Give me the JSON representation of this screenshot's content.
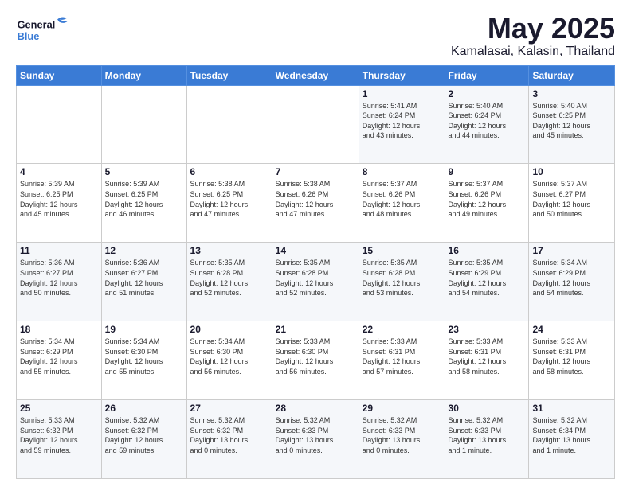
{
  "header": {
    "logo_general": "General",
    "logo_blue": "Blue",
    "title": "May 2025",
    "subtitle": "Kamalasai, Kalasin, Thailand"
  },
  "days_of_week": [
    "Sunday",
    "Monday",
    "Tuesday",
    "Wednesday",
    "Thursday",
    "Friday",
    "Saturday"
  ],
  "weeks": [
    [
      {
        "day": "",
        "info": ""
      },
      {
        "day": "",
        "info": ""
      },
      {
        "day": "",
        "info": ""
      },
      {
        "day": "",
        "info": ""
      },
      {
        "day": "1",
        "info": "Sunrise: 5:41 AM\nSunset: 6:24 PM\nDaylight: 12 hours\nand 43 minutes."
      },
      {
        "day": "2",
        "info": "Sunrise: 5:40 AM\nSunset: 6:24 PM\nDaylight: 12 hours\nand 44 minutes."
      },
      {
        "day": "3",
        "info": "Sunrise: 5:40 AM\nSunset: 6:25 PM\nDaylight: 12 hours\nand 45 minutes."
      }
    ],
    [
      {
        "day": "4",
        "info": "Sunrise: 5:39 AM\nSunset: 6:25 PM\nDaylight: 12 hours\nand 45 minutes."
      },
      {
        "day": "5",
        "info": "Sunrise: 5:39 AM\nSunset: 6:25 PM\nDaylight: 12 hours\nand 46 minutes."
      },
      {
        "day": "6",
        "info": "Sunrise: 5:38 AM\nSunset: 6:25 PM\nDaylight: 12 hours\nand 47 minutes."
      },
      {
        "day": "7",
        "info": "Sunrise: 5:38 AM\nSunset: 6:26 PM\nDaylight: 12 hours\nand 47 minutes."
      },
      {
        "day": "8",
        "info": "Sunrise: 5:37 AM\nSunset: 6:26 PM\nDaylight: 12 hours\nand 48 minutes."
      },
      {
        "day": "9",
        "info": "Sunrise: 5:37 AM\nSunset: 6:26 PM\nDaylight: 12 hours\nand 49 minutes."
      },
      {
        "day": "10",
        "info": "Sunrise: 5:37 AM\nSunset: 6:27 PM\nDaylight: 12 hours\nand 50 minutes."
      }
    ],
    [
      {
        "day": "11",
        "info": "Sunrise: 5:36 AM\nSunset: 6:27 PM\nDaylight: 12 hours\nand 50 minutes."
      },
      {
        "day": "12",
        "info": "Sunrise: 5:36 AM\nSunset: 6:27 PM\nDaylight: 12 hours\nand 51 minutes."
      },
      {
        "day": "13",
        "info": "Sunrise: 5:35 AM\nSunset: 6:28 PM\nDaylight: 12 hours\nand 52 minutes."
      },
      {
        "day": "14",
        "info": "Sunrise: 5:35 AM\nSunset: 6:28 PM\nDaylight: 12 hours\nand 52 minutes."
      },
      {
        "day": "15",
        "info": "Sunrise: 5:35 AM\nSunset: 6:28 PM\nDaylight: 12 hours\nand 53 minutes."
      },
      {
        "day": "16",
        "info": "Sunrise: 5:35 AM\nSunset: 6:29 PM\nDaylight: 12 hours\nand 54 minutes."
      },
      {
        "day": "17",
        "info": "Sunrise: 5:34 AM\nSunset: 6:29 PM\nDaylight: 12 hours\nand 54 minutes."
      }
    ],
    [
      {
        "day": "18",
        "info": "Sunrise: 5:34 AM\nSunset: 6:29 PM\nDaylight: 12 hours\nand 55 minutes."
      },
      {
        "day": "19",
        "info": "Sunrise: 5:34 AM\nSunset: 6:30 PM\nDaylight: 12 hours\nand 55 minutes."
      },
      {
        "day": "20",
        "info": "Sunrise: 5:34 AM\nSunset: 6:30 PM\nDaylight: 12 hours\nand 56 minutes."
      },
      {
        "day": "21",
        "info": "Sunrise: 5:33 AM\nSunset: 6:30 PM\nDaylight: 12 hours\nand 56 minutes."
      },
      {
        "day": "22",
        "info": "Sunrise: 5:33 AM\nSunset: 6:31 PM\nDaylight: 12 hours\nand 57 minutes."
      },
      {
        "day": "23",
        "info": "Sunrise: 5:33 AM\nSunset: 6:31 PM\nDaylight: 12 hours\nand 58 minutes."
      },
      {
        "day": "24",
        "info": "Sunrise: 5:33 AM\nSunset: 6:31 PM\nDaylight: 12 hours\nand 58 minutes."
      }
    ],
    [
      {
        "day": "25",
        "info": "Sunrise: 5:33 AM\nSunset: 6:32 PM\nDaylight: 12 hours\nand 59 minutes."
      },
      {
        "day": "26",
        "info": "Sunrise: 5:32 AM\nSunset: 6:32 PM\nDaylight: 12 hours\nand 59 minutes."
      },
      {
        "day": "27",
        "info": "Sunrise: 5:32 AM\nSunset: 6:32 PM\nDaylight: 13 hours\nand 0 minutes."
      },
      {
        "day": "28",
        "info": "Sunrise: 5:32 AM\nSunset: 6:33 PM\nDaylight: 13 hours\nand 0 minutes."
      },
      {
        "day": "29",
        "info": "Sunrise: 5:32 AM\nSunset: 6:33 PM\nDaylight: 13 hours\nand 0 minutes."
      },
      {
        "day": "30",
        "info": "Sunrise: 5:32 AM\nSunset: 6:33 PM\nDaylight: 13 hours\nand 1 minute."
      },
      {
        "day": "31",
        "info": "Sunrise: 5:32 AM\nSunset: 6:34 PM\nDaylight: 13 hours\nand 1 minute."
      }
    ]
  ]
}
